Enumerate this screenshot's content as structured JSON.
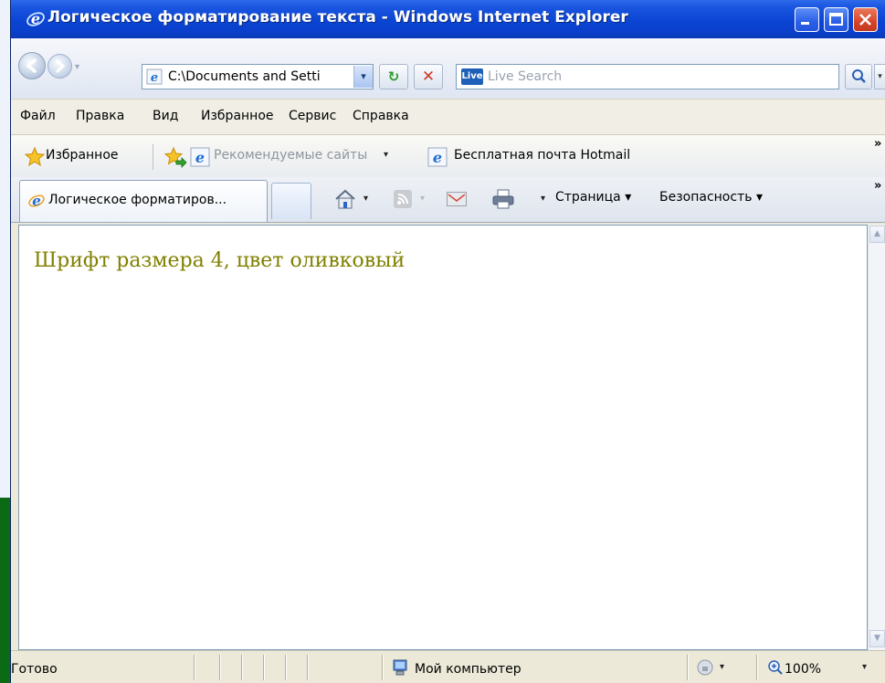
{
  "window": {
    "title": "Логическое форматирование текста - Windows Internet Explorer"
  },
  "address": {
    "value": "C:\\Documents and Setti"
  },
  "search": {
    "placeholder": "Live Search",
    "logo_text": "Live"
  },
  "menu": {
    "items": [
      "Файл",
      "Правка",
      "Вид",
      "Избранное",
      "Сервис",
      "Справка"
    ]
  },
  "favorites": {
    "label": "Избранное",
    "links": [
      "Рекомендуемые сайты",
      "Бесплатная почта Hotmail"
    ]
  },
  "tabs": {
    "active_label": "Логическое форматиров..."
  },
  "command_bar": {
    "page_label": "Страница",
    "safety_label": "Безопасность"
  },
  "content": {
    "text": "Шрифт размера 4, цвет оливковый",
    "text_color": "#808000"
  },
  "status": {
    "text": "Готово",
    "zone": "Мой компьютер",
    "zoom": "100%"
  },
  "icons": {
    "dropdown": "▾",
    "chevron": "»",
    "scroll_up": "▲",
    "scroll_down": "▼",
    "refresh": "↻",
    "stop": "✕",
    "addr_drop": "▾"
  }
}
